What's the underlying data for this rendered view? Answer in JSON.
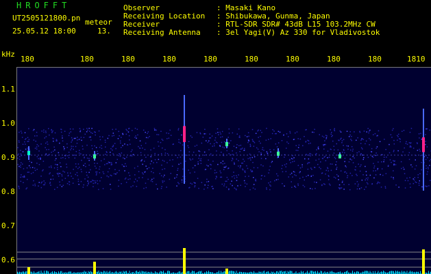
{
  "brand": "HROFFT",
  "file": {
    "name": "UT2505121800.pn",
    "meteor_label": "meteor",
    "datetime": "25.05.12 18:00",
    "count": "13."
  },
  "header": [
    {
      "key": "Observer",
      "value": ": Masaki Kano"
    },
    {
      "key": "Receiving Location",
      "value": ": Shibukawa, Gunma, Japan"
    },
    {
      "key": "Receiver",
      "value": ": RTL-SDR SDR# 43dB L15 103.2MHz CW"
    },
    {
      "key": "Receiving Antenna",
      "value": ": 3el Yagi(V) Az 330 for Vladivostok"
    }
  ],
  "axis": {
    "unit": "kHz",
    "y_ticks": [
      "1.1",
      "1.0",
      "0.9",
      "0.8",
      "0.7",
      "0.6"
    ],
    "x_ticks": [
      "180",
      "180",
      "180",
      "180",
      "180",
      "180",
      "180",
      "180",
      "180",
      "1810"
    ]
  },
  "colors": {
    "header_text": "#ffff00",
    "brand": "#22dd22",
    "noise": "#2222aa",
    "echo_hot": "#ff2288",
    "baseline": "#00e5ff",
    "peak": "#ffff00"
  }
}
